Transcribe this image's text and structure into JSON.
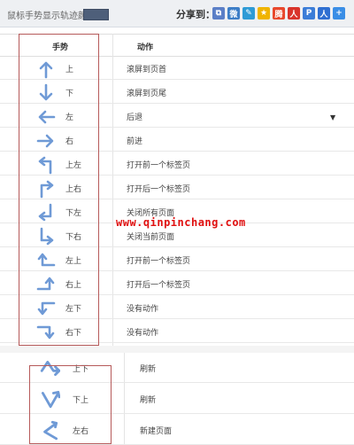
{
  "toolbar": {
    "title": "鼠标手势显示轨迹颜色",
    "trail_color": "#4e5f7a",
    "share_label": "分享到："
  },
  "share_icons": [
    {
      "name": "copy-share-icon",
      "glyph": "⧉",
      "color": "#5b7fc7"
    },
    {
      "name": "weibo-share-icon",
      "glyph": "微",
      "color": "#3d7ec7"
    },
    {
      "name": "edit-share-icon",
      "glyph": "✎",
      "color": "#2e9bd6"
    },
    {
      "name": "qzone-share-icon",
      "glyph": "★",
      "color": "#f0b400"
    },
    {
      "name": "tencent-weibo-share-icon",
      "glyph": "腾",
      "color": "#e8472c"
    },
    {
      "name": "renren-share-icon",
      "glyph": "人",
      "color": "#d9342b"
    },
    {
      "name": "pengyou-share-icon",
      "glyph": "P",
      "color": "#3b7dd8"
    },
    {
      "name": "kaixin-share-icon",
      "glyph": "人",
      "color": "#2f6fd1"
    },
    {
      "name": "more-share-icon",
      "glyph": "+",
      "color": "#3a8ee6"
    }
  ],
  "table": {
    "header_gesture": "手势",
    "header_action": "动作",
    "rows": [
      {
        "arrow": "up",
        "dir": "上",
        "action": "滚屏到页首"
      },
      {
        "arrow": "down",
        "dir": "下",
        "action": "滚屏到页尾"
      },
      {
        "arrow": "left",
        "dir": "左",
        "action": "后退"
      },
      {
        "arrow": "right",
        "dir": "右",
        "action": "前进"
      },
      {
        "arrow": "up-left",
        "dir": "上左",
        "action": "打开前一个标签页"
      },
      {
        "arrow": "up-right",
        "dir": "上右",
        "action": "打开后一个标签页"
      },
      {
        "arrow": "down-left",
        "dir": "下左",
        "action": "关闭所有页面"
      },
      {
        "arrow": "down-right",
        "dir": "下右",
        "action": "关闭当前页面"
      },
      {
        "arrow": "left-up",
        "dir": "左上",
        "action": "打开前一个标签页"
      },
      {
        "arrow": "right-up",
        "dir": "右上",
        "action": "打开后一个标签页"
      },
      {
        "arrow": "left-down",
        "dir": "左下",
        "action": "没有动作"
      },
      {
        "arrow": "right-down",
        "dir": "右下",
        "action": "没有动作"
      }
    ]
  },
  "dropdown_caret": "▼",
  "watermark": "www.qinpinchang.com",
  "lower_rows": [
    {
      "arrow": "up-down",
      "dir": "上下",
      "action": "刷新"
    },
    {
      "arrow": "down-up",
      "dir": "下上",
      "action": "刷新"
    },
    {
      "arrow": "left-right",
      "dir": "左右",
      "action": "新建页面"
    }
  ],
  "colors": {
    "arrow": "#6f9ad6",
    "highlight_box": "#b65a5a"
  }
}
